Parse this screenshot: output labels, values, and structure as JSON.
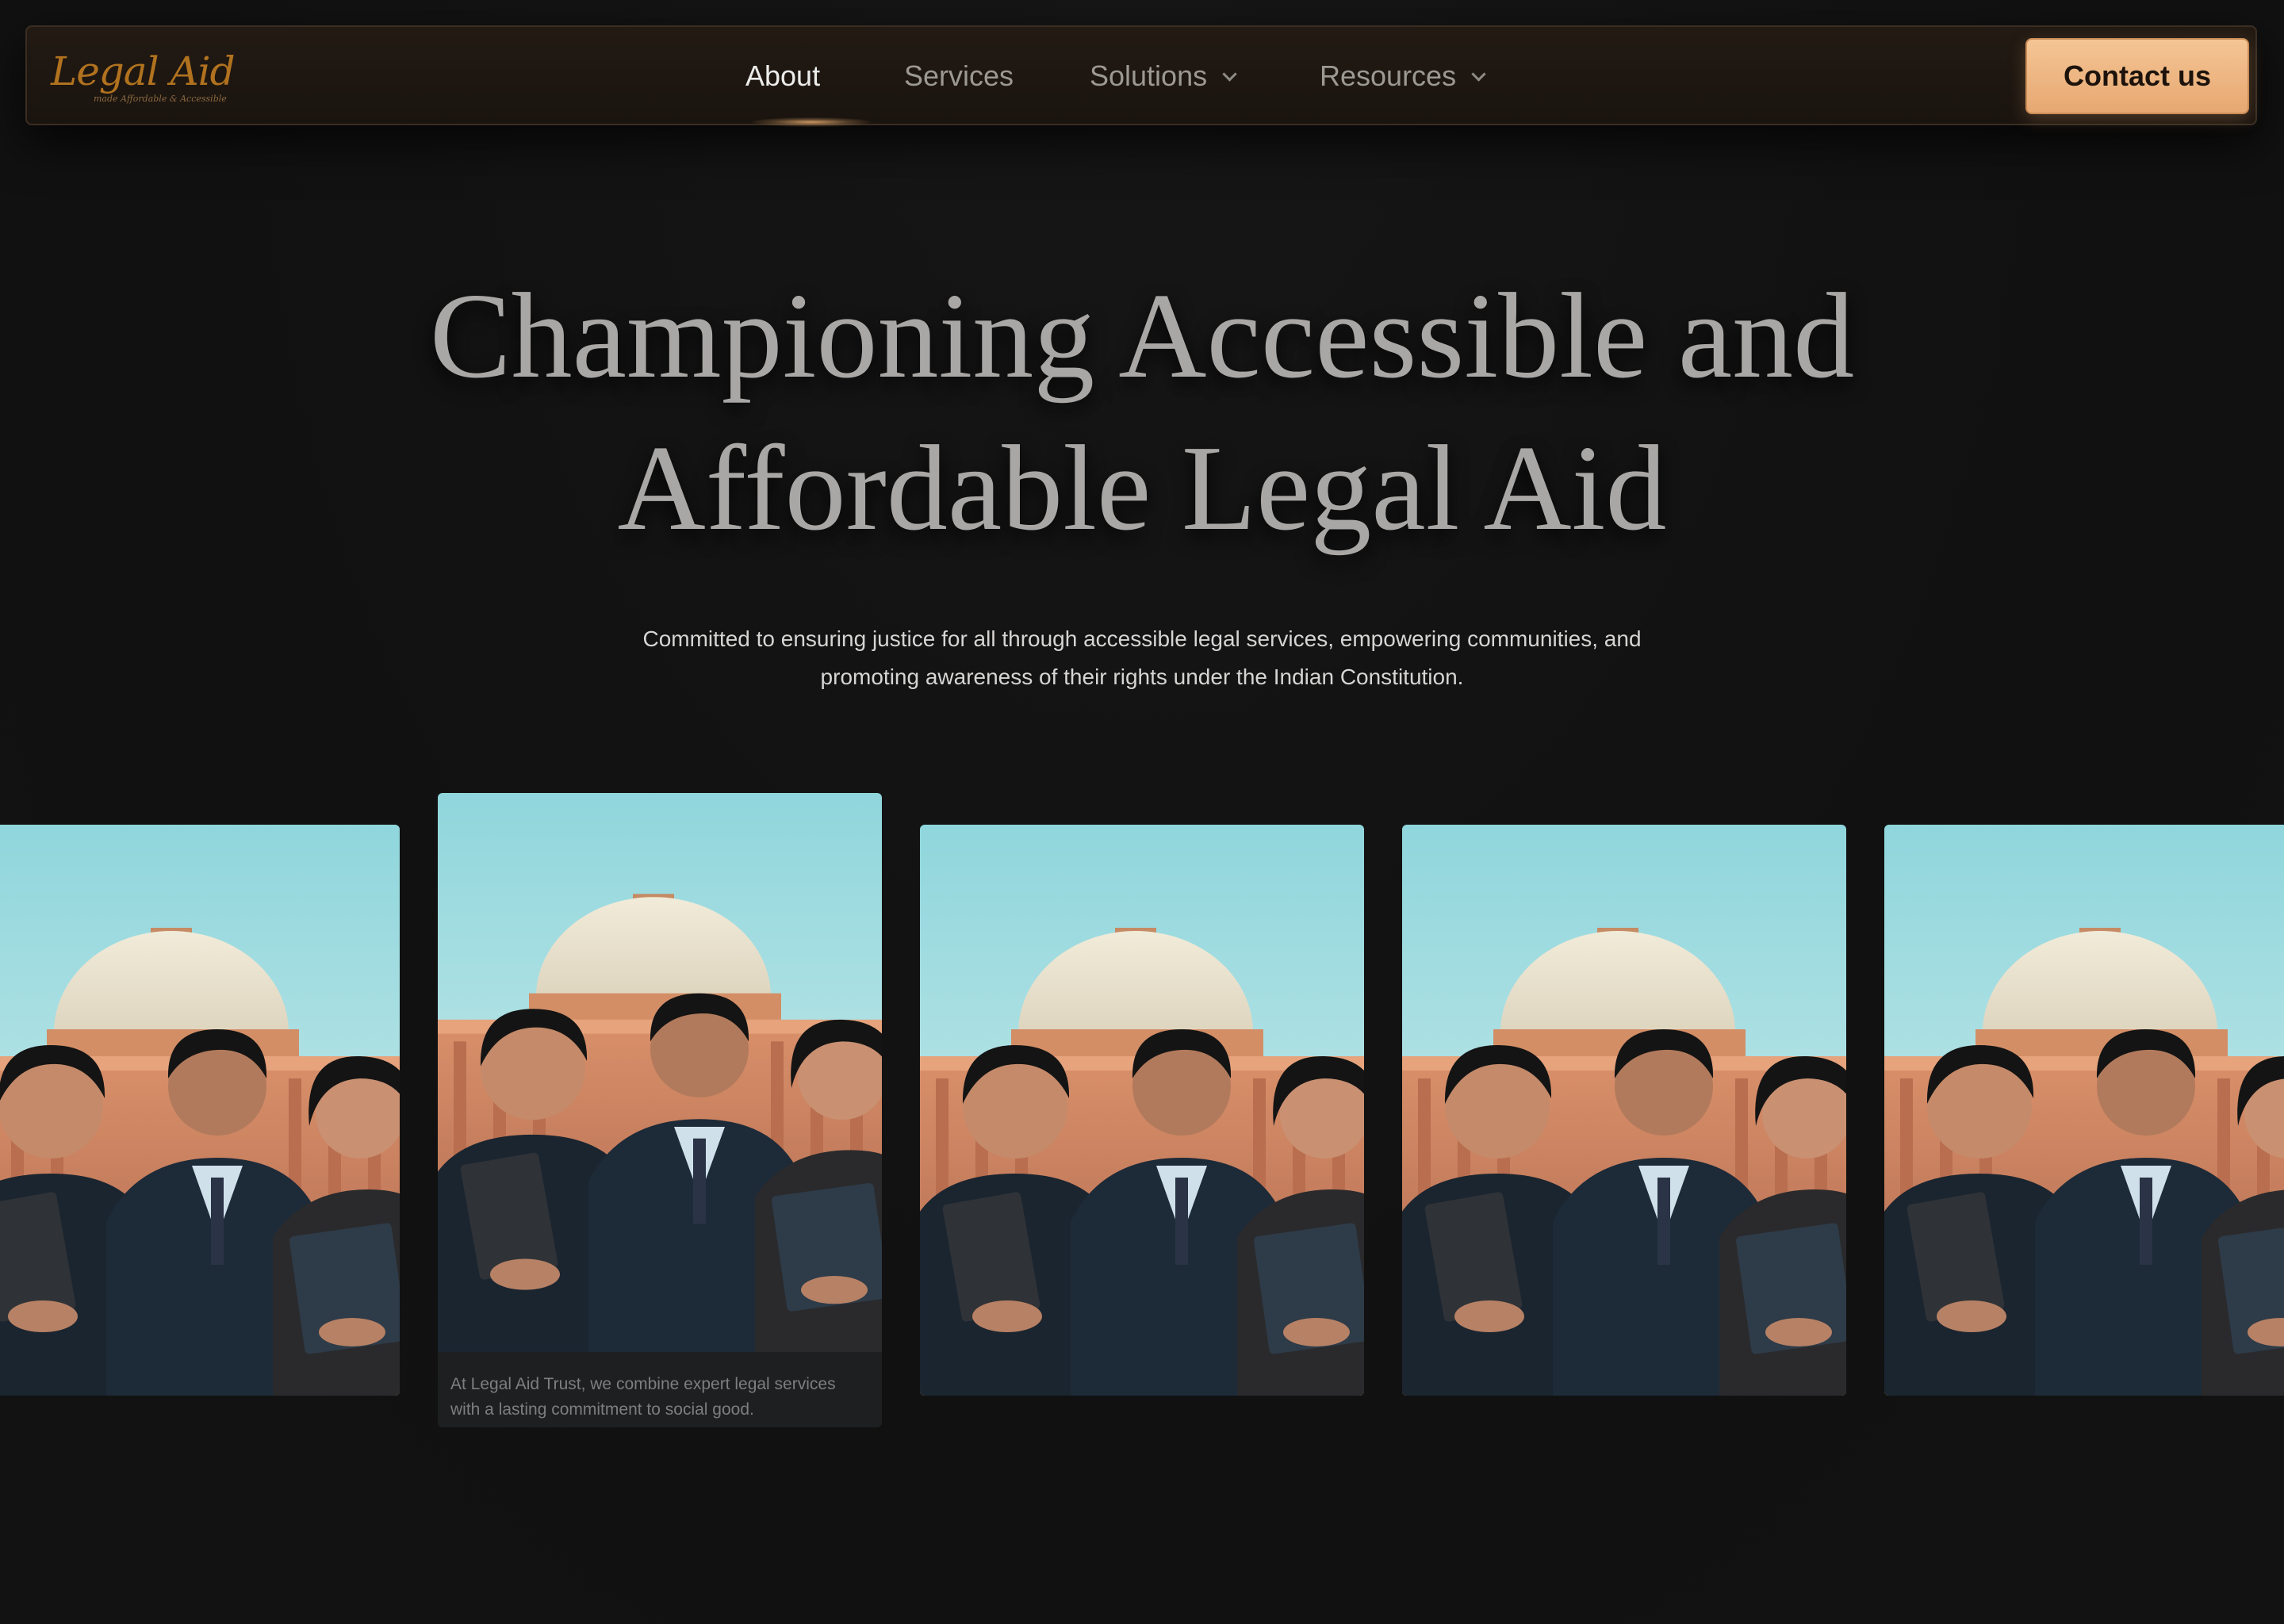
{
  "nav": {
    "logo": {
      "title": "Legal Aid",
      "tagline": "made Affordable & Accessible"
    },
    "links": [
      {
        "label": "About",
        "active": true,
        "has_dropdown": false
      },
      {
        "label": "Services",
        "active": false,
        "has_dropdown": false
      },
      {
        "label": "Solutions",
        "active": false,
        "has_dropdown": true
      },
      {
        "label": "Resources",
        "active": false,
        "has_dropdown": true
      }
    ],
    "cta_label": "Contact us"
  },
  "hero": {
    "title_line1": "Championing Accessible and",
    "title_line2": "Affordable Legal Aid",
    "subtitle_line1": "Committed to ensuring justice for all through accessible legal services, empowering communities, and",
    "subtitle_line2": "promoting awareness of their rights under the Indian Constitution."
  },
  "carousel": {
    "featured_card_index": 1,
    "featured_caption_line1": "At Legal Aid Trust, we combine expert legal services",
    "featured_caption_line2": "with a lasting commitment to social good.",
    "card_count": 5,
    "photo_subject": "three lawyers in suits holding folders in front of a domed court building"
  },
  "colors": {
    "background": "#121212",
    "accent": "#e8a870",
    "logo": "#b1721f",
    "nav_bg": "#1e1711"
  }
}
